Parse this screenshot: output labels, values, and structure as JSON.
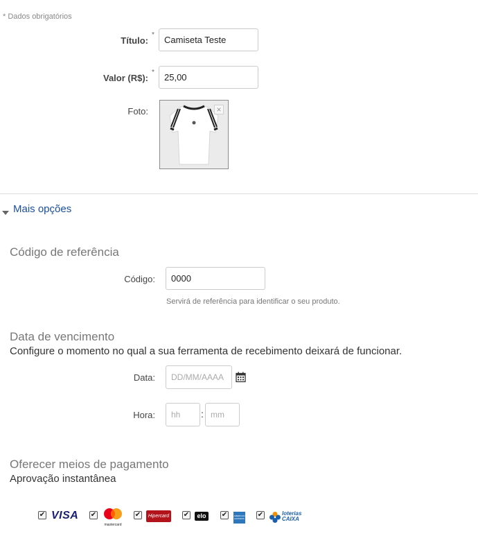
{
  "required_note": "* Dados obrigatórios",
  "title_field": {
    "label": "Título:",
    "required": "*",
    "value": "Camiseta Teste"
  },
  "value_field": {
    "label": "Valor (R$):",
    "required": "*",
    "value": "25,00"
  },
  "photo": {
    "label": "Foto:",
    "remove": "×"
  },
  "more_options": "Mais opções",
  "reference": {
    "title": "Código de referência",
    "label": "Código:",
    "value": "0000",
    "help": "Servirá de referência para identificar o seu produto."
  },
  "expiration": {
    "title": "Data de vencimento",
    "subtitle": "Configure o momento no qual a sua ferramenta de recebimento deixará de funcionar.",
    "date_label": "Data:",
    "date_placeholder": "DD/MM/AAAA",
    "time_label": "Hora:",
    "hour_placeholder": "hh",
    "separator": ":",
    "minute_placeholder": "mm"
  },
  "payment": {
    "title": "Oferecer meios de pagamento",
    "subtitle": "Aprovação instantânea",
    "methods": [
      {
        "name": "visa",
        "logo_text": "VISA",
        "checked": true
      },
      {
        "name": "mastercard",
        "logo_text": "mastercard",
        "checked": true
      },
      {
        "name": "hipercard",
        "logo_text": "Hipercard",
        "checked": true
      },
      {
        "name": "elo",
        "logo_text": "elo",
        "checked": true
      },
      {
        "name": "amex",
        "logo_text": "AMERICAN EXPRESS",
        "checked": true
      },
      {
        "name": "loterias-caixa",
        "logo_text": "loterias CAIXA",
        "checked": true
      }
    ]
  },
  "colors": {
    "link": "#1a4fa0",
    "border": "#cccccc",
    "divider": "#dcdcdc"
  }
}
